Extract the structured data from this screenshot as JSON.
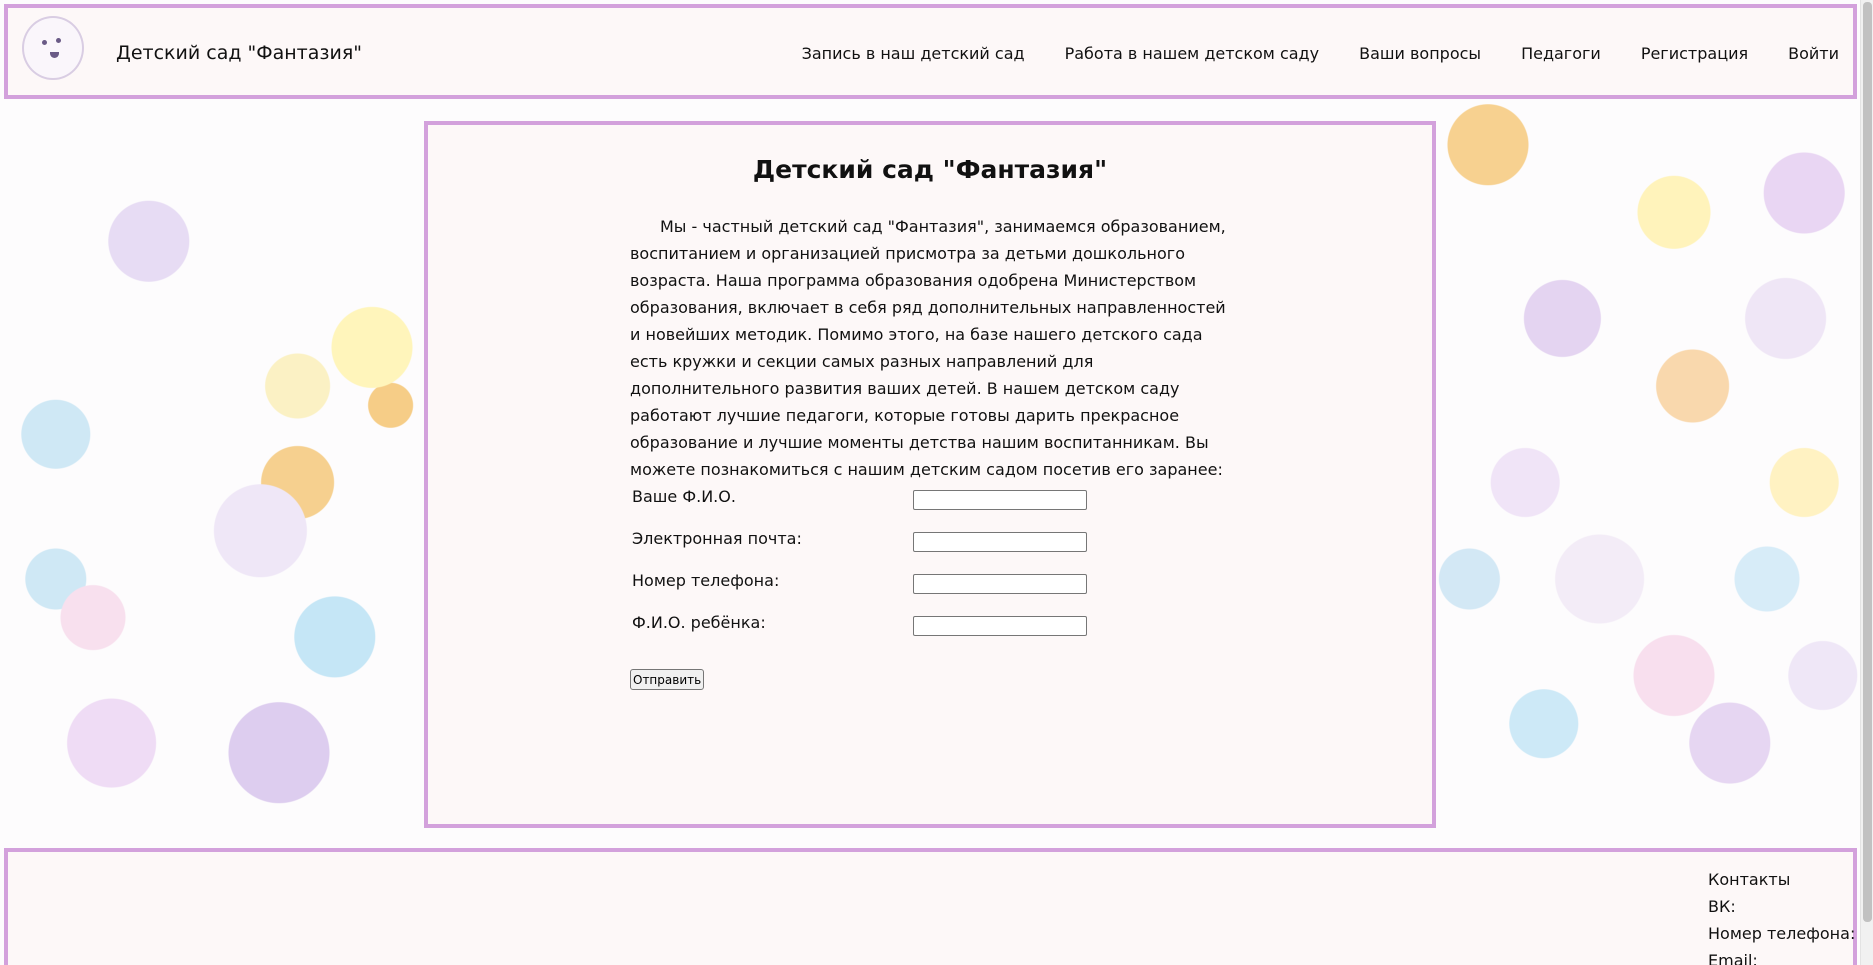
{
  "header": {
    "site_title": "Детский сад \"Фантазия\"",
    "nav": [
      "Запись в наш детский сад",
      "Работа в нашем детском саду",
      "Ваши вопросы",
      "Педагоги",
      "Регистрация",
      "Войти"
    ]
  },
  "main": {
    "title": "Детский сад \"Фантазия\"",
    "intro": "Мы - частный детский сад \"Фантазия\", занимаемся образованием, воспитанием и организацией присмотра за детьми дошкольного возраста. Наша программа образования одобрена Министерством образования, включает в себя ряд дополнительных направленностей и новейших методик. Помимо этого, на базе нашего детского сада есть кружки и секции самых разных направлений для дополнительного развития ваших детей. В нашем детском саду работают лучшие педагоги, которые готовы дарить прекрасное образование и лучшие моменты детства нашим воспитанникам. Вы можете познакомиться с нашим детским садом посетив его заранее:",
    "form": {
      "fields": [
        {
          "label": "Ваше Ф.И.О.",
          "value": ""
        },
        {
          "label": "Электронная почта:",
          "value": ""
        },
        {
          "label": "Номер телефона:",
          "value": ""
        },
        {
          "label": "Ф.И.О. ребёнка:",
          "value": ""
        }
      ],
      "submit_label": "Отправить"
    }
  },
  "footer": {
    "contacts_title": "Контакты",
    "vk_label": "ВК:",
    "phone_label": "Номер телефона:",
    "email_label": "Email:"
  },
  "theme": {
    "border_color": "#d3a1dc",
    "panel_background": "#fdf8f8"
  }
}
